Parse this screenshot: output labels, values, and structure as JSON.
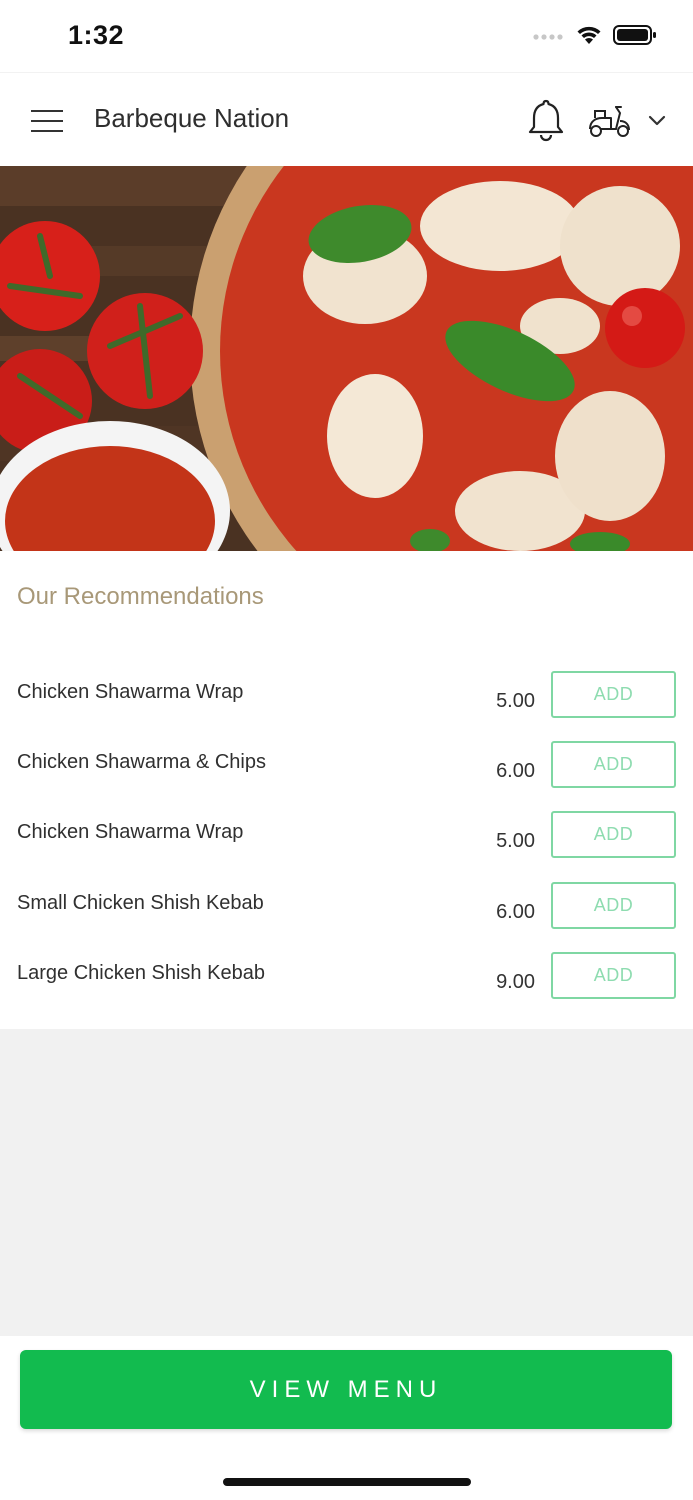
{
  "status_bar": {
    "time": "1:32",
    "icons": [
      "signal-icon",
      "wifi-icon",
      "battery-icon"
    ]
  },
  "header": {
    "title": "Barbeque Nation",
    "icons": [
      "hamburger-menu-icon",
      "bell-icon",
      "scooter-icon",
      "chevron-down-icon"
    ]
  },
  "hero": {
    "image": "pizza-with-tomatoes-hero-image"
  },
  "recommendations": {
    "title": "Our Recommendations",
    "items": [
      {
        "name": "Chicken Shawarma Wrap",
        "price": "5.00",
        "action": "ADD"
      },
      {
        "name": "Chicken Shawarma & Chips",
        "price": "6.00",
        "action": "ADD"
      },
      {
        "name": "Chicken Shawarma Wrap",
        "price": "5.00",
        "action": "ADD"
      },
      {
        "name": "Small Chicken Shish Kebab",
        "price": "6.00",
        "action": "ADD"
      },
      {
        "name": "Large Chicken Shish Kebab",
        "price": "9.00",
        "action": "ADD"
      }
    ]
  },
  "footer": {
    "view_menu_label": "VIEW MENU"
  },
  "colors": {
    "primary_green": "#12bb4f",
    "add_border": "#7fd7a3",
    "section_title": "#a89878",
    "empty_area": "#f1f1f1"
  }
}
